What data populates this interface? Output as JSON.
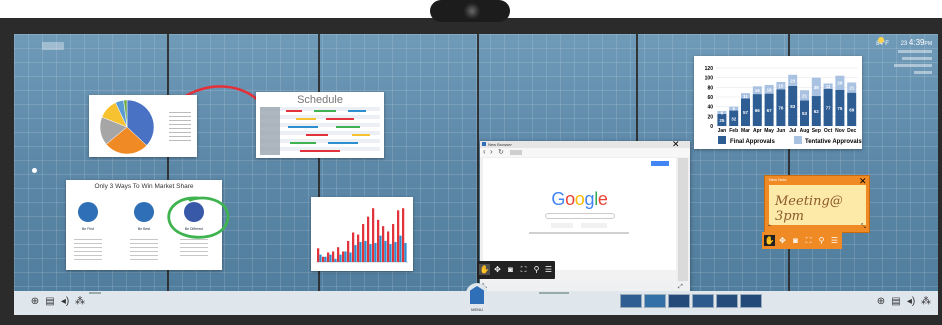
{
  "weather": {
    "temperature": "84°F",
    "date_number": "23",
    "time": "4:39",
    "ampm": "PM"
  },
  "schedule": {
    "title": "Schedule"
  },
  "market_share": {
    "title": "Only 3 Ways To Win Market Share",
    "items": [
      {
        "label": "Be First"
      },
      {
        "label": "Be Best"
      },
      {
        "label": "Be Different"
      }
    ]
  },
  "browser": {
    "tab_title": "New Browser",
    "search_logo": "Google"
  },
  "sticky_note": {
    "header": "New Note",
    "text": "Meeting@ 3pm"
  },
  "menu": {
    "center_label": "MENU"
  },
  "colors": {
    "accent_orange": "#f08a24",
    "screen_blue": "#5d88a8",
    "note_yellow": "#fde9a8",
    "ink_green": "#3fb34f",
    "ink_red": "#e2333b",
    "chart_blue": "#2e5d94",
    "chart_light": "#a9c2e2"
  },
  "chart_data": [
    {
      "type": "bar",
      "categories": [
        "Jan",
        "Feb",
        "Mar",
        "Apr",
        "May",
        "Jun",
        "Jul",
        "Aug",
        "Sep",
        "Oct",
        "Nov",
        "Dec"
      ],
      "ylim": [
        0,
        120
      ],
      "yticks": [
        "0",
        "20",
        "40",
        "60",
        "80",
        "100",
        "120"
      ],
      "series": [
        {
          "name": "Final Approvals",
          "values": [
            25,
            32,
            57,
            66,
            67,
            76,
            83,
            53,
            62,
            77,
            75,
            69
          ]
        },
        {
          "name": "Tentative Approvals*",
          "values": [
            6,
            8,
            11,
            16,
            18,
            15,
            23,
            21,
            38,
            11,
            29,
            21
          ]
        }
      ],
      "stacked": true,
      "legend": "bottom"
    },
    {
      "type": "pie",
      "values": [
        37,
        27,
        17,
        12,
        5,
        2
      ],
      "colors": [
        "#4a72c4",
        "#f08a24",
        "#a6a6a6",
        "#f7c22f",
        "#5b9bd5",
        "#70ad47"
      ]
    },
    {
      "type": "bar",
      "series": [
        {
          "values": [
            13,
            5,
            9,
            10,
            14,
            10,
            20,
            28,
            26,
            36,
            43,
            51,
            40,
            34,
            29,
            36,
            49,
            51
          ]
        },
        {
          "values": [
            7,
            5,
            7,
            3,
            7,
            10,
            9,
            16,
            19,
            20,
            17,
            18,
            25,
            20,
            17,
            19,
            25,
            18
          ]
        }
      ]
    }
  ]
}
